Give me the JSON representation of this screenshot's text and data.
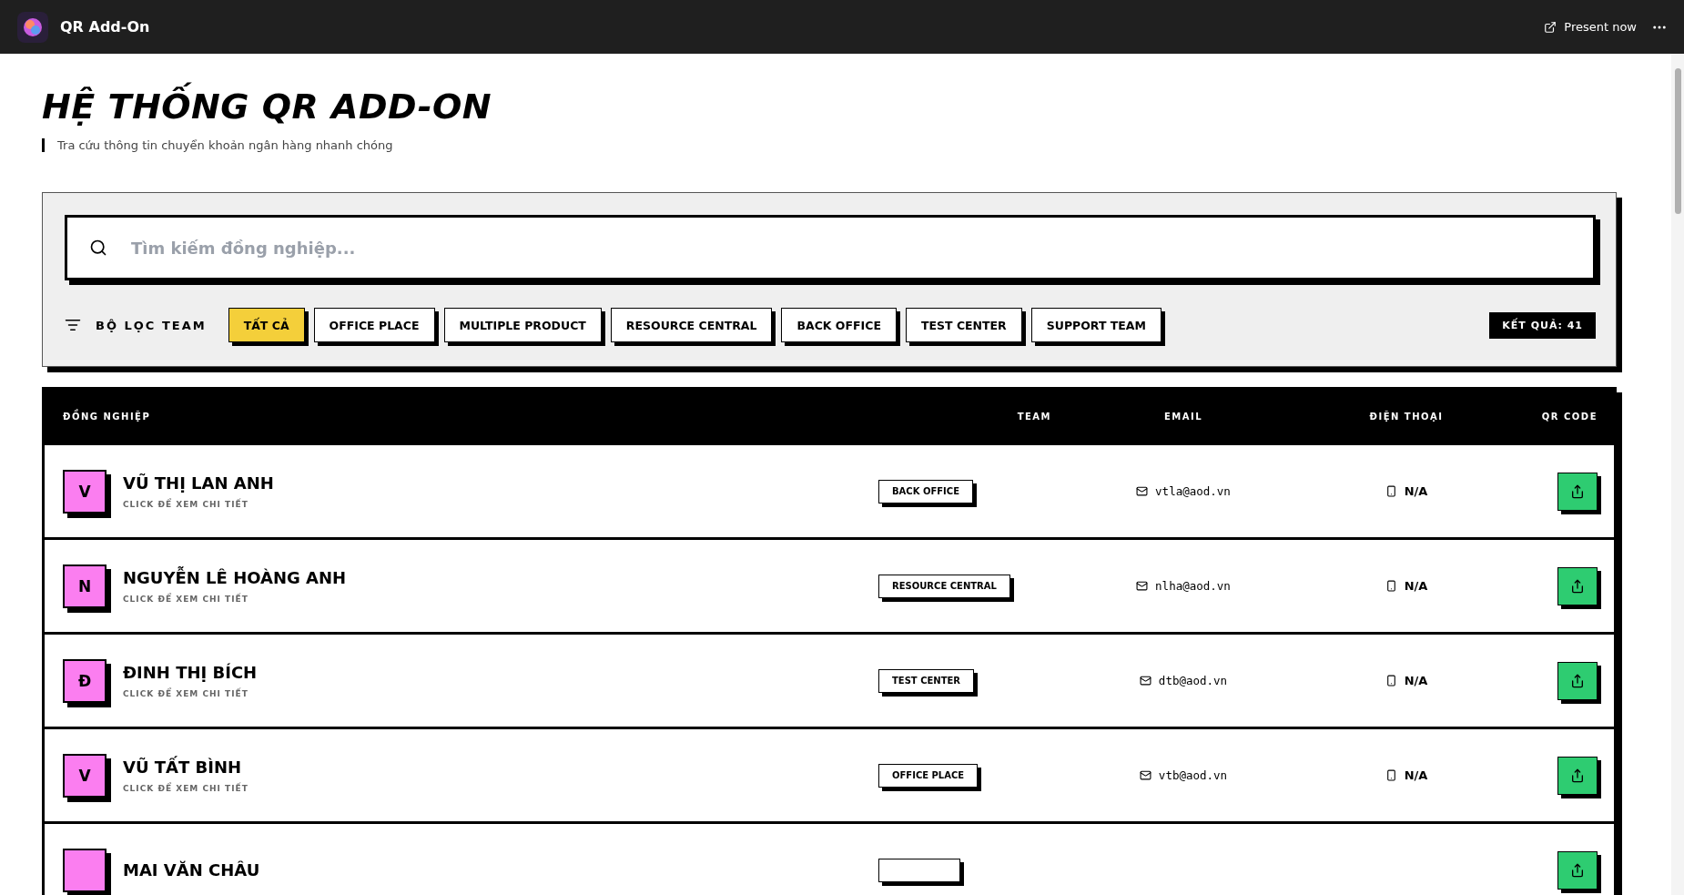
{
  "top_bar": {
    "app_name": "QR Add-On",
    "present_label": "Present now"
  },
  "title": "HỆ THỐNG QR ADD-ON",
  "subtitle": "Tra cứu thông tin chuyển khoản ngân hàng nhanh chóng",
  "search": {
    "placeholder": "Tìm kiếm đồng nghiệp..."
  },
  "filter": {
    "label": "BỘ LỌC TEAM",
    "result_count": "KẾT QUẢ: 41",
    "teams": [
      {
        "label": "TẤT CẢ",
        "selected": true
      },
      {
        "label": "OFFICE PLACE",
        "selected": false
      },
      {
        "label": "MULTIPLE PRODUCT",
        "selected": false
      },
      {
        "label": "RESOURCE CENTRAL",
        "selected": false
      },
      {
        "label": "BACK OFFICE",
        "selected": false
      },
      {
        "label": "TEST CENTER",
        "selected": false
      },
      {
        "label": "SUPPORT TEAM",
        "selected": false
      }
    ]
  },
  "table": {
    "columns": [
      "ĐỒNG NGHIỆP",
      "TEAM",
      "EMAIL",
      "ĐIỆN THOẠI",
      "QR CODE"
    ],
    "rows": [
      {
        "avatar": "V",
        "name": "VŨ THỊ LAN ANH",
        "hint": "CLICK ĐỂ XEM CHI TIẾT",
        "team": "BACK OFFICE",
        "email": "vtla@aod.vn",
        "phone": "N/A"
      },
      {
        "avatar": "N",
        "name": "NGUYỄN LÊ HOÀNG ANH",
        "hint": "CLICK ĐỂ XEM CHI TIẾT",
        "team": "RESOURCE CENTRAL",
        "email": "nlha@aod.vn",
        "phone": "N/A"
      },
      {
        "avatar": "Đ",
        "name": "ĐINH THỊ BÍCH",
        "hint": "CLICK ĐỂ XEM CHI TIẾT",
        "team": "TEST CENTER",
        "email": "dtb@aod.vn",
        "phone": "N/A"
      },
      {
        "avatar": "V",
        "name": "VŨ TẤT BÌNH",
        "hint": "CLICK ĐỂ XEM CHI TIẾT",
        "team": "OFFICE PLACE",
        "email": "vtb@aod.vn",
        "phone": "N/A"
      },
      {
        "name": "MAI VĂN CHÂU"
      }
    ]
  }
}
